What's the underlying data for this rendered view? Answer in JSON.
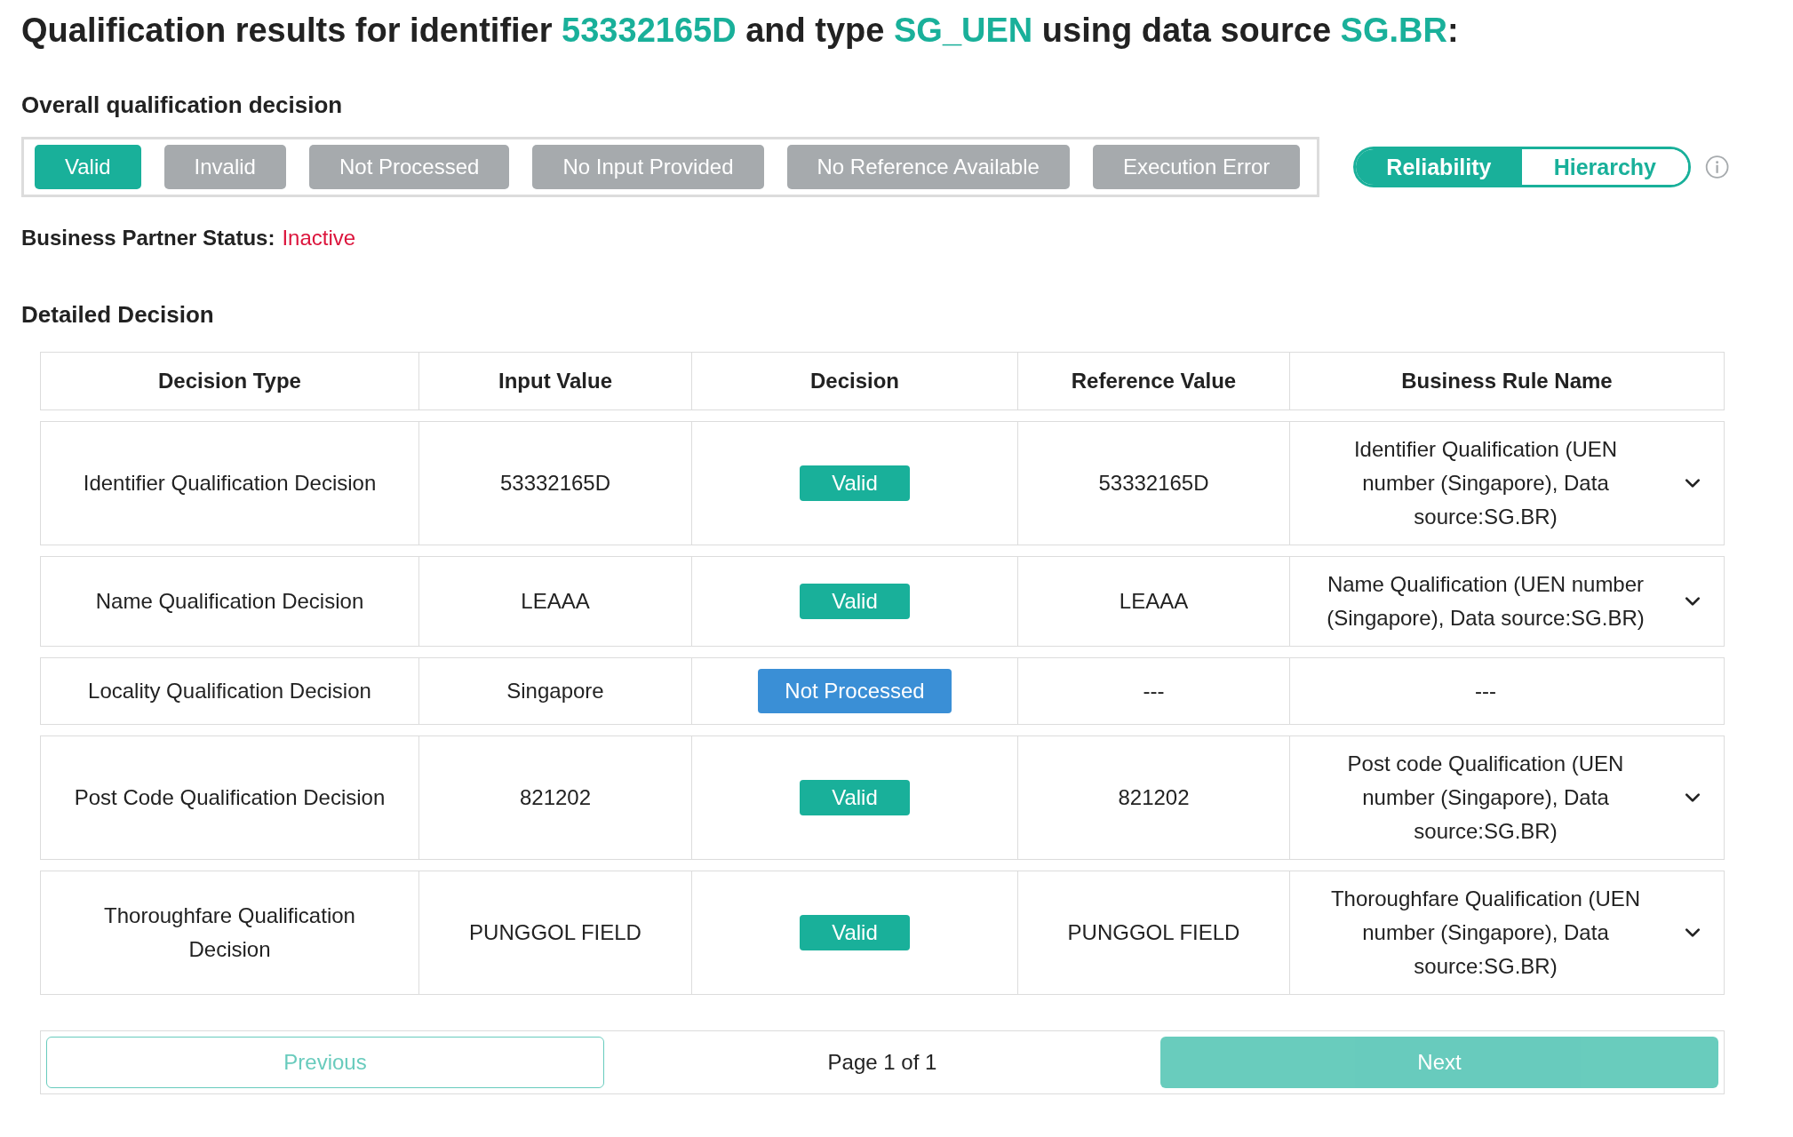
{
  "title": {
    "parts": [
      {
        "text": "Qualification results for identifier ",
        "highlight": false
      },
      {
        "text": "53332165D",
        "highlight": true
      },
      {
        "text": " and type ",
        "highlight": false
      },
      {
        "text": "SG_UEN",
        "highlight": true
      },
      {
        "text": " using data source ",
        "highlight": false
      },
      {
        "text": "SG.BR",
        "highlight": true
      },
      {
        "text": ":",
        "highlight": false
      }
    ]
  },
  "overall": {
    "heading": "Overall qualification decision",
    "options": [
      {
        "label": "Valid",
        "selected": true
      },
      {
        "label": "Invalid",
        "selected": false
      },
      {
        "label": "Not Processed",
        "selected": false
      },
      {
        "label": "No Input Provided",
        "selected": false
      },
      {
        "label": "No Reference Available",
        "selected": false
      },
      {
        "label": "Execution Error",
        "selected": false
      }
    ]
  },
  "view_toggle": [
    {
      "label": "Reliability",
      "selected": true
    },
    {
      "label": "Hierarchy",
      "selected": false
    }
  ],
  "partner_status": {
    "label": "Business Partner Status:",
    "value": "Inactive"
  },
  "detailed": {
    "heading": "Detailed Decision",
    "columns": [
      "Decision Type",
      "Input Value",
      "Decision",
      "Reference Value",
      "Business Rule Name"
    ],
    "rows": [
      {
        "type": "Identifier Qualification Decision",
        "input": "53332165D",
        "decision": {
          "label": "Valid",
          "kind": "valid"
        },
        "reference": "53332165D",
        "rule": "Identifier Qualification (UEN number (Singapore), Data source:SG.BR)",
        "expandable": true
      },
      {
        "type": "Name Qualification Decision",
        "input": "LEAAA",
        "decision": {
          "label": "Valid",
          "kind": "valid"
        },
        "reference": "LEAAA",
        "rule": "Name Qualification (UEN number (Singapore), Data source:SG.BR)",
        "expandable": true
      },
      {
        "type": "Locality Qualification Decision",
        "input": "Singapore",
        "decision": {
          "label": "Not Processed",
          "kind": "not_processed"
        },
        "reference": "---",
        "rule": "---",
        "expandable": false
      },
      {
        "type": "Post Code Qualification Decision",
        "input": "821202",
        "decision": {
          "label": "Valid",
          "kind": "valid"
        },
        "reference": "821202",
        "rule": "Post code Qualification (UEN number (Singapore), Data source:SG.BR)",
        "expandable": true
      },
      {
        "type": "Thoroughfare Qualification Decision",
        "input": "PUNGGOL FIELD",
        "decision": {
          "label": "Valid",
          "kind": "valid"
        },
        "reference": "PUNGGOL FIELD",
        "rule": "Thoroughfare Qualification (UEN number (Singapore), Data source:SG.BR)",
        "expandable": true
      }
    ]
  },
  "pagination": {
    "previous": {
      "label": "Previous",
      "disabled": true
    },
    "page": "Page 1 of 1",
    "next": {
      "label": "Next",
      "disabled": true
    }
  }
}
